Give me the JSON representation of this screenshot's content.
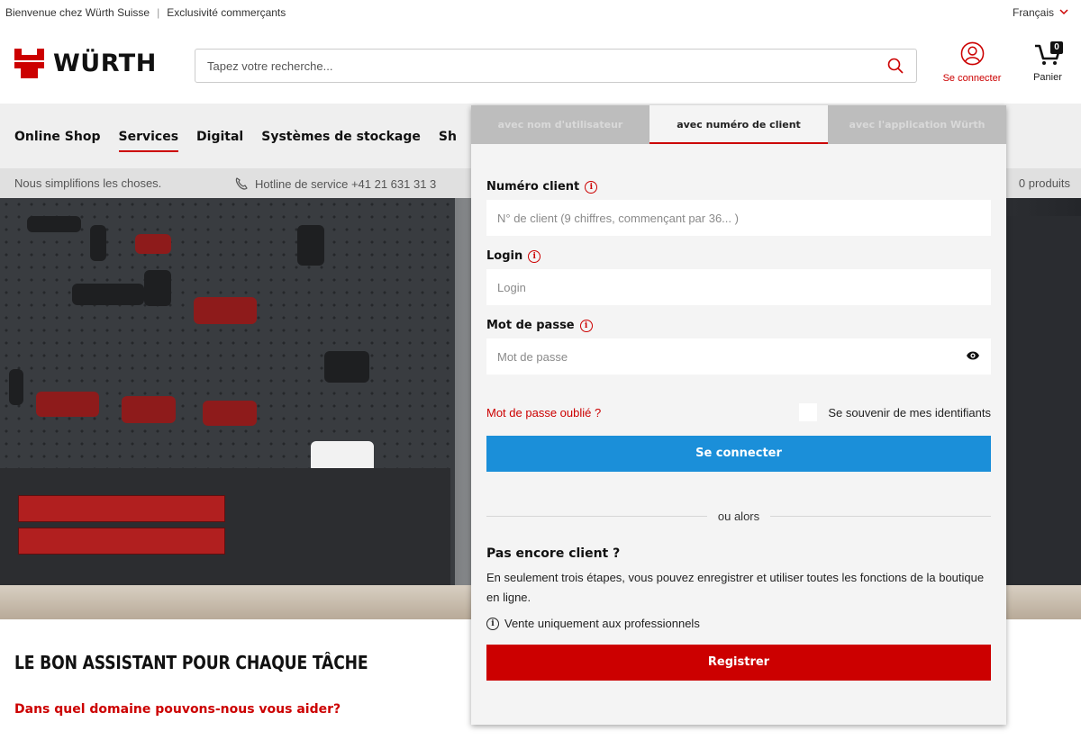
{
  "topbar": {
    "welcome": "Bienvenue chez Würth Suisse",
    "separator": "|",
    "exclusive": "Exclusivité commerçants",
    "language": "Français"
  },
  "header": {
    "logo_text": "WÜRTH",
    "search_placeholder": "Tapez votre recherche...",
    "account_label": "Se connecter",
    "cart_label": "Panier",
    "cart_count": "0"
  },
  "nav": {
    "items": [
      "Online Shop",
      "Services",
      "Digital",
      "Systèmes de stockage",
      "Sh"
    ],
    "active_index": 1
  },
  "subbar": {
    "slogan": "Nous simplifions les choses.",
    "hotline": "Hotline de service +41 21 631 31 3",
    "products": "0 produits"
  },
  "main": {
    "headline": "LE BON ASSISTANT POUR CHAQUE TÂCHE",
    "subhead": "Dans quel domaine pouvons-nous vous aider?"
  },
  "login": {
    "tabs": [
      "avec nom d'utilisateur",
      "avec numéro de client",
      "avec l'application Würth"
    ],
    "active_tab": 1,
    "client_number_label": "Numéro client",
    "client_number_placeholder": "N° de client (9 chiffres, commençant par 36... )",
    "login_label": "Login",
    "login_placeholder": "Login",
    "password_label": "Mot de passe",
    "password_placeholder": "Mot de passe",
    "forgot": "Mot de passe oublié ?",
    "remember": "Se souvenir de mes identifiants",
    "submit": "Se connecter",
    "or": "ou alors",
    "not_client_title": "Pas encore client ?",
    "not_client_desc": "En seulement trois étapes, vous pouvez enregistrer et utiliser toutes les fonctions de la boutique en ligne.",
    "pro_only": "Vente uniquement aux professionnels",
    "register": "Registrer"
  },
  "colors": {
    "brand_red": "#cc0000",
    "button_blue": "#1b8fd9"
  }
}
